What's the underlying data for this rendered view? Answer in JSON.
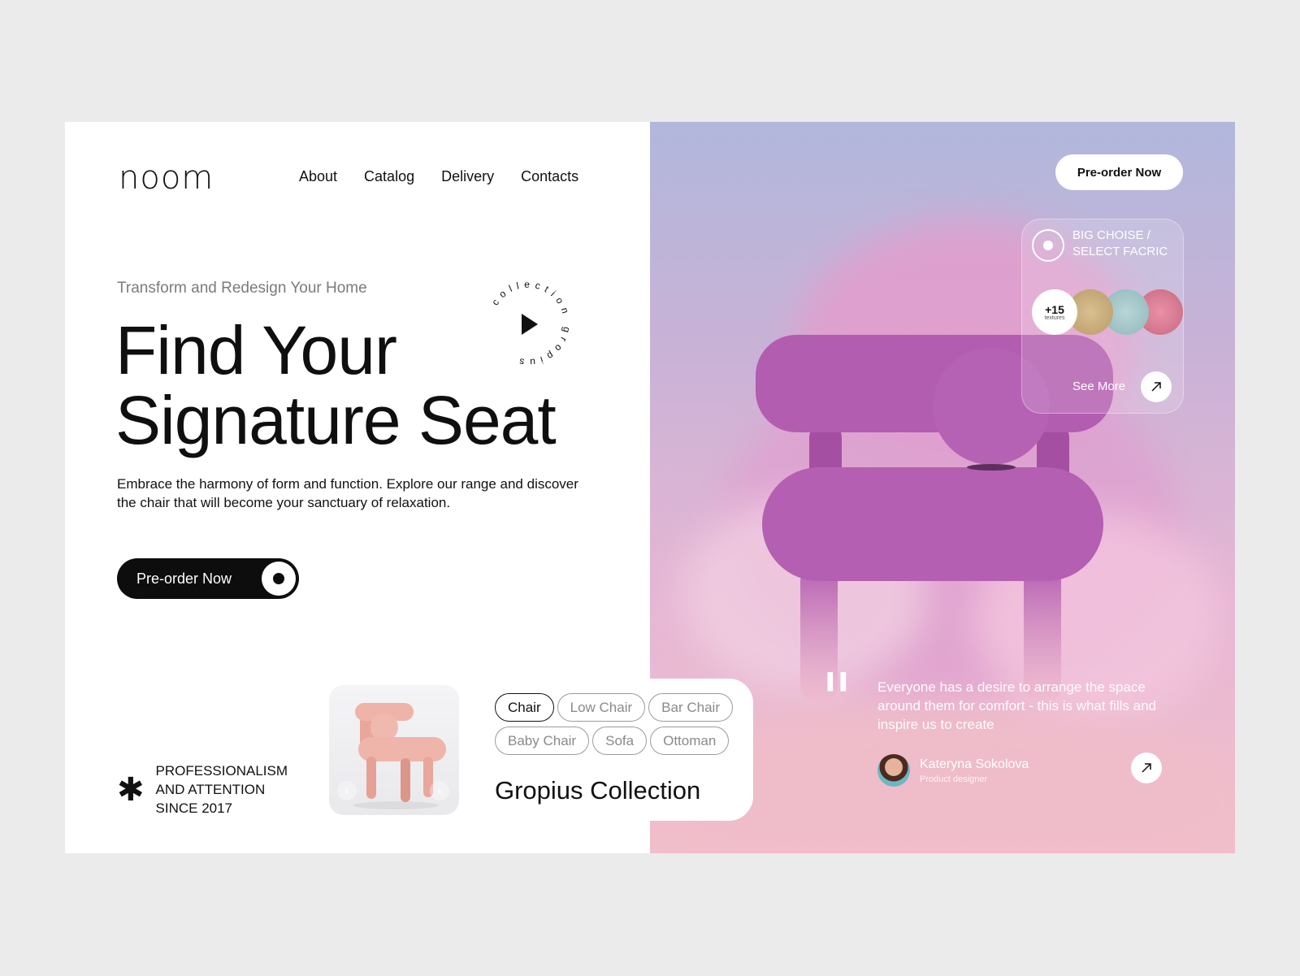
{
  "brand": {
    "logo": "noom"
  },
  "nav": [
    "About",
    "Catalog",
    "Delivery",
    "Contacts"
  ],
  "hero": {
    "eyebrow": "Transform and Redesign Your Home",
    "headline_line1": "Find Your",
    "headline_line2": "Signature Seat",
    "description": "Embrace the harmony of form and function. Explore our range and discover the chair that will become your sanctuary of relaxation.",
    "cta_label": "Pre-order Now",
    "badge_text": "collection gropius"
  },
  "since": {
    "icon": "asterisk-icon",
    "lines": [
      "PROFESSIONALISM",
      "AND ATTENTION",
      "SINCE 2017"
    ]
  },
  "categories": {
    "tags": [
      "Chair",
      "Low Chair",
      "Bar Chair",
      "Baby Chair",
      "Sofa",
      "Ottoman"
    ],
    "active": "Chair",
    "collection_title": "Gropius Collection"
  },
  "right": {
    "preorder_label": "Pre-order Now",
    "fabric": {
      "title_line1": "BIG CHOISE /",
      "title_line2": "SELECT FACRIC",
      "count": "+15",
      "count_label": "textures",
      "swatches": [
        "#c7ab7c",
        "#9fc3c6",
        "#d97b93"
      ],
      "see_more": "See More"
    },
    "testimonial": {
      "quote": "Everyone has a desire to arrange the space around them for comfort - this is what fills and inspire us to create",
      "author": "Kateryna Sokolova",
      "role": "Product designer"
    }
  },
  "colors": {
    "chair": "#b45fb2",
    "dark": "#0d0d0d",
    "sky": "#b1b7dc",
    "thumb_chair": "#eab3ab"
  }
}
